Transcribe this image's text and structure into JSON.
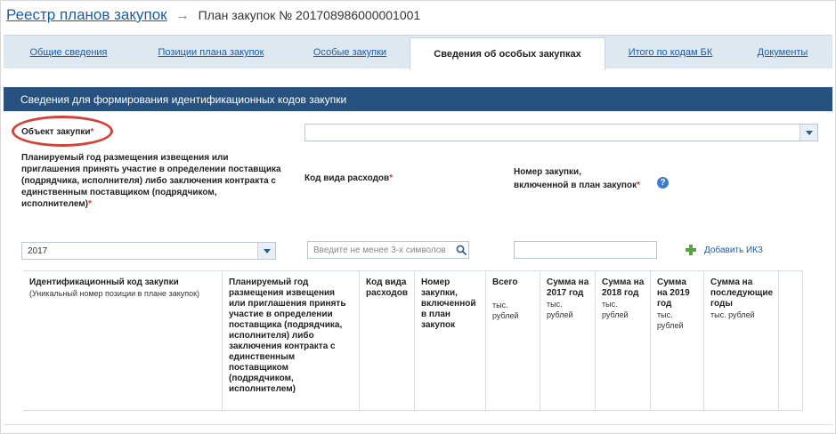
{
  "breadcrumb": {
    "root_link": "Реестр планов закупок",
    "separator": "→",
    "current": "План закупок № 2017089860000​01001"
  },
  "tabs": [
    {
      "label": "Общие сведения",
      "active": false
    },
    {
      "label": "Позиции плана закупок",
      "active": false
    },
    {
      "label": "Особые закупки",
      "active": false
    },
    {
      "label": "Сведения об особых закупках",
      "active": true
    },
    {
      "label": "Итого по кодам БК",
      "active": false
    },
    {
      "label": "Документы",
      "active": false
    }
  ],
  "section": {
    "title": "Сведения для формирования идентификационных кодов закупки"
  },
  "form": {
    "object_label": "Объект закупки",
    "required_mark": "*",
    "object_value": "",
    "year_label": "Планируемый год размещения извещения или приглашения принять участие в определении поставщика (подрядчика, исполнителя) либо заключения контракта с единственным поставщиком (подрядчиком, исполнителем)",
    "year_value": "2017",
    "expense_label": "Код вида расходов",
    "expense_placeholder": "Введите не менее 3-х символов",
    "number_label_line1": "Номер закупки,",
    "number_label_line2": "включенной в план закупок",
    "number_value": "",
    "help_glyph": "?",
    "add_label": "Добавить ИКЗ"
  },
  "table": {
    "columns": [
      {
        "title": "Идентификационный код закупки",
        "sub": "(Уникальный номер позиции в плане закупок)"
      },
      {
        "title": "Планируемый год размещения извещения или приглашения принять участие в определении поставщика (подрядчика, исполнителя) либо заключения контракта с единственным поставщиком (подрядчиком, исполнителем)",
        "sub": ""
      },
      {
        "title": "Код вида расходов",
        "sub": ""
      },
      {
        "title": "Номер закупки, включенной в план закупок",
        "sub": ""
      },
      {
        "title": "Всего",
        "sub": "тыс. рублей"
      },
      {
        "title": "Сумма на 2017 год",
        "sub": "тыс. рублей"
      },
      {
        "title": "Сумма на 2018 год",
        "sub": "тыс. рублей"
      },
      {
        "title": "Сумма на 2019 год",
        "sub": "тыс. рублей"
      },
      {
        "title": "Сумма на последующие годы",
        "sub": "тыс. рублей"
      },
      {
        "title": "",
        "sub": ""
      }
    ]
  },
  "colors": {
    "link": "#1a5ea8",
    "section_header": "#27527f",
    "tab_bar": "#dde8f1",
    "highlight": "#d64038",
    "add_icon": "#5aa342"
  },
  "icons": {
    "search": "search-icon",
    "dropdown": "chevron-down-icon",
    "help": "help-icon",
    "add": "plus-icon"
  }
}
